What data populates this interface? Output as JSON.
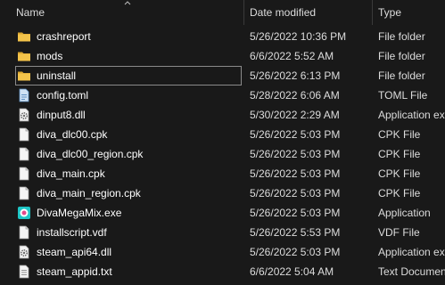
{
  "header": {
    "name_label": "Name",
    "date_label": "Date modified",
    "type_label": "Type"
  },
  "files": [
    {
      "name": "crashreport",
      "date": "5/26/2022 10:36 PM",
      "type": "File folder",
      "icon": "folder-icon"
    },
    {
      "name": "mods",
      "date": "6/6/2022 5:52 AM",
      "type": "File folder",
      "icon": "folder-icon"
    },
    {
      "name": "uninstall",
      "date": "5/26/2022 6:13 PM",
      "type": "File folder",
      "icon": "folder-icon",
      "selected": true
    },
    {
      "name": "config.toml",
      "date": "5/28/2022 6:06 AM",
      "type": "TOML File",
      "icon": "toml-file-icon"
    },
    {
      "name": "dinput8.dll",
      "date": "5/30/2022 2:29 AM",
      "type": "Application ex",
      "icon": "dll-gear-icon"
    },
    {
      "name": "diva_dlc00.cpk",
      "date": "5/26/2022 5:03 PM",
      "type": "CPK File",
      "icon": "blank-file-icon"
    },
    {
      "name": "diva_dlc00_region.cpk",
      "date": "5/26/2022 5:03 PM",
      "type": "CPK File",
      "icon": "blank-file-icon"
    },
    {
      "name": "diva_main.cpk",
      "date": "5/26/2022 5:03 PM",
      "type": "CPK File",
      "icon": "blank-file-icon"
    },
    {
      "name": "diva_main_region.cpk",
      "date": "5/26/2022 5:03 PM",
      "type": "CPK File",
      "icon": "blank-file-icon"
    },
    {
      "name": "DivaMegaMix.exe",
      "date": "5/26/2022 5:03 PM",
      "type": "Application",
      "icon": "divamegamix-app-icon"
    },
    {
      "name": "installscript.vdf",
      "date": "5/26/2022 5:53 PM",
      "type": "VDF File",
      "icon": "blank-file-icon"
    },
    {
      "name": "steam_api64.dll",
      "date": "5/26/2022 5:03 PM",
      "type": "Application ex",
      "icon": "dll-gear-icon"
    },
    {
      "name": "steam_appid.txt",
      "date": "6/6/2022 5:04 AM",
      "type": "Text Documen",
      "icon": "text-file-icon"
    }
  ],
  "colors": {
    "background": "#191919",
    "folder": "#f3c34a",
    "selection_outline": "#8a8a8a"
  }
}
